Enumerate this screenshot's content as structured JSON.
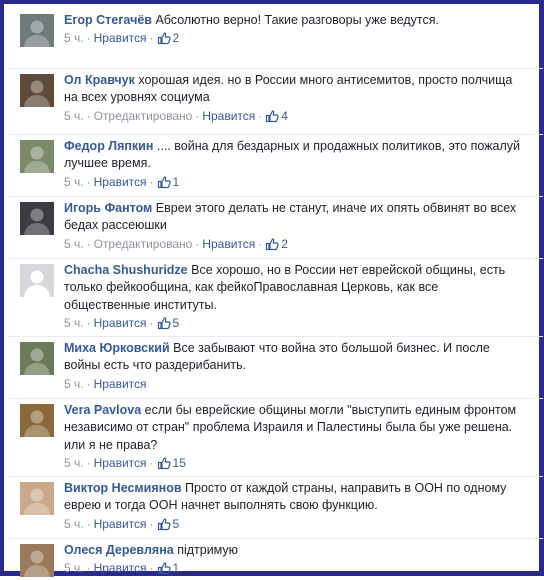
{
  "comments": [
    {
      "author": "Егор Стегачёв",
      "text": "Абсолютно верно! Такие разговоры уже ведутся.",
      "time": "5 ч.",
      "edited": "",
      "like_label": "Нравится",
      "likes": "2",
      "avatar_color": "#6f7a7d"
    },
    {
      "author": "Ол Кравчук",
      "text": "хорошая идея. но в России много антисемитов, просто полчища на всех уровнях социума",
      "time": "5 ч.",
      "edited": "Отредактировано",
      "like_label": "Нравится",
      "likes": "4",
      "avatar_color": "#5d4a3a"
    },
    {
      "author": "Федор Ляпкин",
      "text": ".... война для бездарных и продажных политиков, это пожалуй лучшее время.",
      "time": "5 ч.",
      "edited": "",
      "like_label": "Нравится",
      "likes": "1",
      "avatar_color": "#7b8b6a"
    },
    {
      "author": "Игорь Фантом",
      "text": "Евреи этого делать не станут, иначе их опять обвинят во всех бедах рассеюшки",
      "time": "5 ч.",
      "edited": "Отредактировано",
      "like_label": "Нравится",
      "likes": "2",
      "avatar_color": "#3e3a44"
    },
    {
      "author": "Chacha Shushuridze",
      "text": "Все хорошо, но в России нет еврейской общины, есть только фейкообщина, как фейкоПравославная Церковь, как все общественные институты.",
      "time": "5 ч.",
      "edited": "",
      "like_label": "Нравится",
      "likes": "5",
      "avatar_color": "#d6d8db"
    },
    {
      "author": "Миха Юрковский",
      "text": "Все забывают что война это большой бизнес. И после войны есть что раздерибанить.",
      "time": "5 ч.",
      "edited": "",
      "like_label": "Нравится",
      "likes": "",
      "avatar_color": "#6b7a58"
    },
    {
      "author": "Vera Pavlova",
      "text": "если бы еврейские общины могли \"выступить единым фронтом независимо от стран\" проблема Израиля и Палестины была бы уже решена. или я не права?",
      "time": "5 ч.",
      "edited": "",
      "like_label": "Нравится",
      "likes": "15",
      "avatar_color": "#8a6a3a"
    },
    {
      "author": "Виктор Несмиянов",
      "text": "Просто от каждой страны, направить в ООН по одному еврею и тогда ООН начнет выполнять свою функцию.",
      "time": "5 ч.",
      "edited": "",
      "like_label": "Нравится",
      "likes": "5",
      "avatar_color": "#c9a98a"
    },
    {
      "author": "Олеся Деревляна",
      "text": "підтримую",
      "time": "5 ч.",
      "edited": "",
      "like_label": "Нравится",
      "likes": "1",
      "avatar_color": "#9a7a5a"
    }
  ],
  "icons": {
    "like": "thumbs-up-icon"
  },
  "colors": {
    "link": "#365899",
    "meta": "#90949c",
    "text": "#1d2129",
    "frame": "#2a2a8e"
  }
}
